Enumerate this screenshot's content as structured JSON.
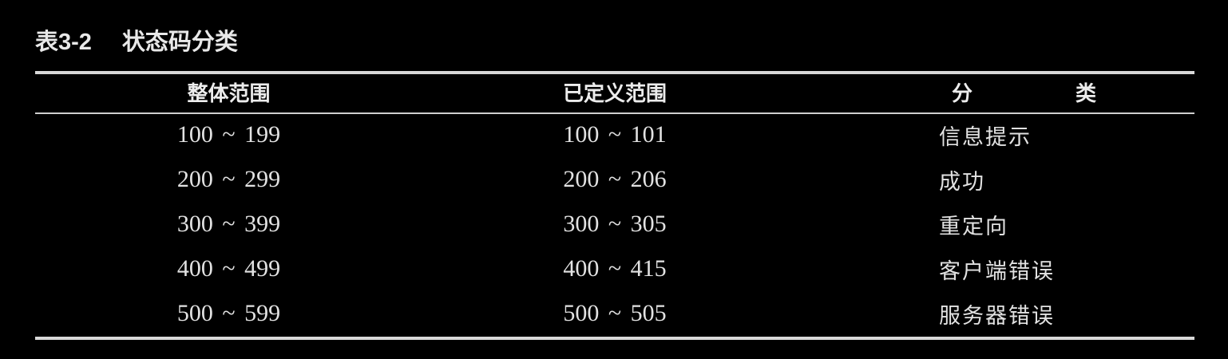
{
  "caption": {
    "number": "表3-2",
    "title": "状态码分类"
  },
  "table": {
    "headers": [
      "整体范围",
      "已定义范围",
      "分 类"
    ],
    "rows": [
      [
        "100 ~ 199",
        "100 ~ 101",
        "信息提示"
      ],
      [
        "200 ~ 299",
        "200 ~ 206",
        "成功"
      ],
      [
        "300 ~ 399",
        "300 ~ 305",
        "重定向"
      ],
      [
        "400 ~ 499",
        "400 ~ 415",
        "客户端错误"
      ],
      [
        "500 ~ 599",
        "500 ~ 505",
        "服务器错误"
      ]
    ]
  }
}
